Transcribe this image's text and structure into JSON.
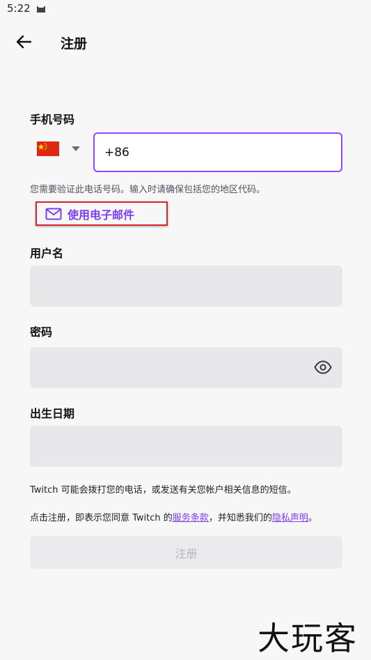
{
  "status_bar": {
    "time": "5:22",
    "icon": "cat-icon"
  },
  "header": {
    "title": "注册",
    "back_icon": "arrow-left-icon"
  },
  "phone": {
    "label": "手机号码",
    "country_flag": "china-flag-icon",
    "value": "+86",
    "helper": "您需要验证此电话号码。输入时请确保包括您的地区代码。"
  },
  "use_email": {
    "label": "使用电子邮件",
    "icon": "mail-icon"
  },
  "username": {
    "label": "用户名",
    "value": ""
  },
  "password": {
    "label": "密码",
    "value": "",
    "icon": "eye-icon"
  },
  "birthdate": {
    "label": "出生日期",
    "value": ""
  },
  "notices": {
    "sms": "Twitch 可能会拨打您的电话，或发送有关您帐户相关信息的短信。",
    "terms_prefix": "点击注册，即表示您同意 Twitch 的",
    "terms_link": "服务条款",
    "terms_middle": "，并知悉我们的",
    "privacy_link": "隐私声明",
    "terms_suffix": "。"
  },
  "submit": {
    "label": "注册"
  },
  "watermark": "大玩客",
  "colors": {
    "accent": "#9147ff",
    "highlight_border": "#d6252b",
    "field_bg": "#e8e8ea"
  }
}
